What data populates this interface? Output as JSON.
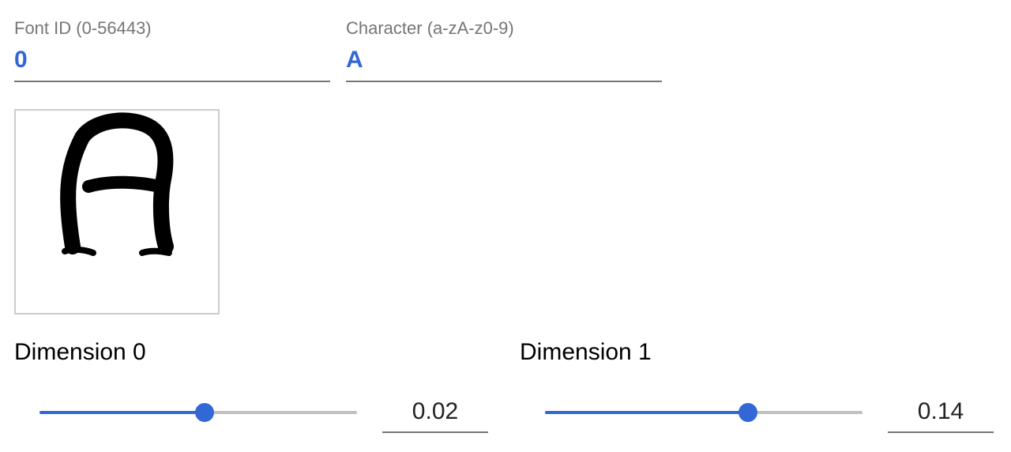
{
  "font_id": {
    "label": "Font ID (0-56443)",
    "value": "0"
  },
  "character": {
    "label": "Character (a-zA-z0-9)",
    "value": "A"
  },
  "dimensions": [
    {
      "label": "Dimension 0",
      "value": "0.02",
      "slider_fraction": 0.52
    },
    {
      "label": "Dimension 1",
      "value": "0.14",
      "slider_fraction": 0.64
    }
  ],
  "colors": {
    "accent": "#3367d6",
    "track": "#c0c0c0",
    "label": "#757575"
  }
}
